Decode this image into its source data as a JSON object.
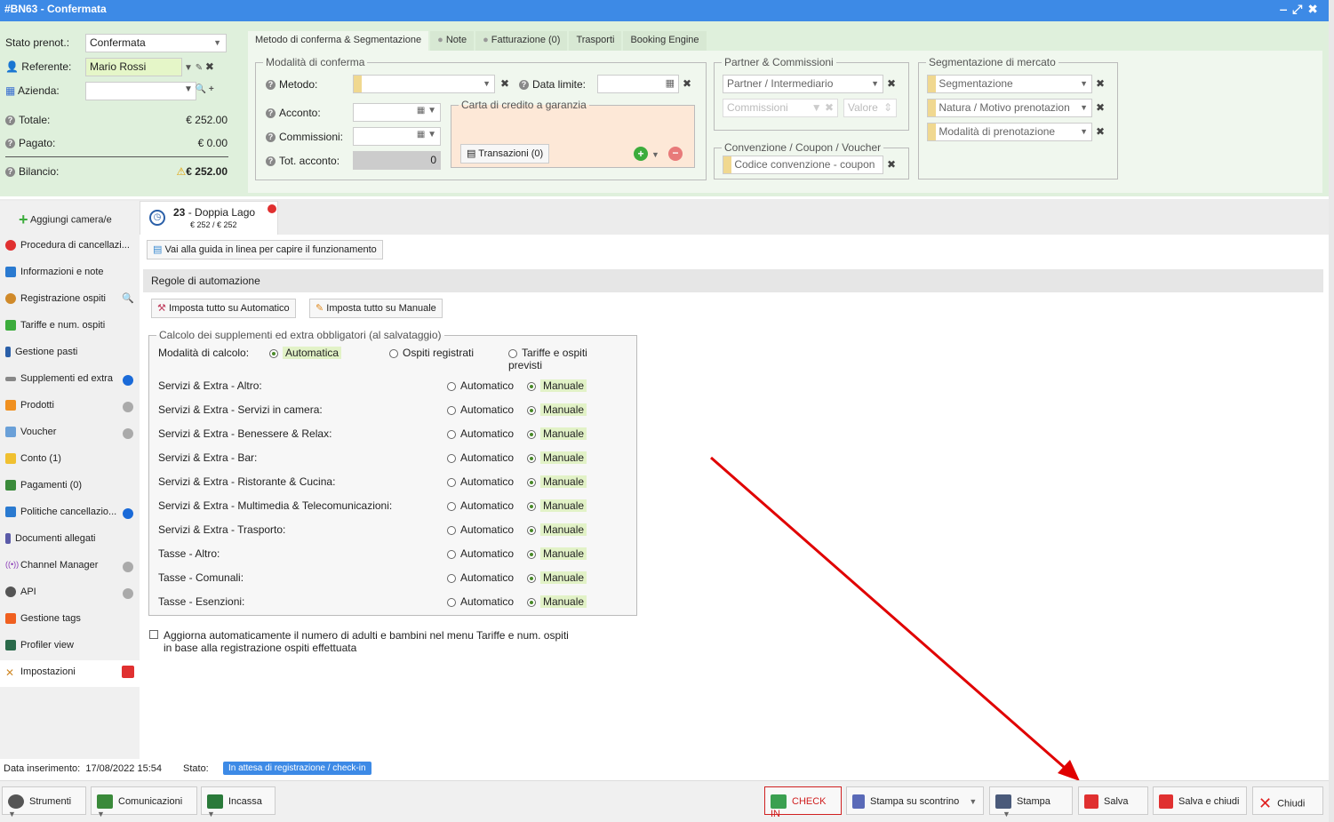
{
  "window": {
    "title": "#BN63 - Confermata"
  },
  "header": {
    "stato_label": "Stato prenot.:",
    "stato_value": "Confermata",
    "referente_label": "Referente:",
    "referente_value": "Mario Rossi",
    "azienda_label": "Azienda:",
    "totale_label": "Totale:",
    "totale_value": "€ 252.00",
    "pagato_label": "Pagato:",
    "pagato_value": "€ 0.00",
    "bilancio_label": "Bilancio:",
    "bilancio_value": "€ 252.00"
  },
  "tabs": [
    "Metodo di conferma & Segmentazione",
    "Note",
    "Fatturazione (0)",
    "Trasporti",
    "Booking Engine"
  ],
  "conferma": {
    "legend": "Modalità di conferma",
    "metodo": "Metodo:",
    "data_limite": "Data limite:",
    "acconto": "Acconto:",
    "commissioni": "Commissioni:",
    "tot_acconto": "Tot. acconto:",
    "tot_acconto_value": "0",
    "carta_legend": "Carta di credito a garanzia",
    "transazioni": "Transazioni (0)"
  },
  "partner": {
    "legend": "Partner & Commissioni",
    "intermediario": "Partner / Intermediario",
    "commissioni": "Commissioni",
    "valore": "Valore"
  },
  "convenzione": {
    "legend": "Convenzione / Coupon / Voucher",
    "codice": "Codice convenzione - coupon"
  },
  "segmentazione": {
    "legend": "Segmentazione di mercato",
    "seg": "Segmentazione",
    "natura": "Natura / Motivo prenotazion",
    "modalita": "Modalità di prenotazione"
  },
  "room": {
    "number": "23",
    "name": " - Doppia Lago",
    "price": "€ 252 / € 252"
  },
  "sidebar": {
    "add": "Aggiungi camera/e",
    "items": [
      "Procedura di cancellazi...",
      "Informazioni e note",
      "Registrazione ospiti",
      "Tariffe e num. ospiti",
      "Gestione pasti",
      "Supplementi ed extra",
      "Prodotti",
      "Voucher",
      "Conto (1)",
      "Pagamenti (0)",
      "Politiche cancellazio...",
      "Documenti allegati",
      "Channel Manager",
      "API",
      "Gestione tags",
      "Profiler view",
      "Impostazioni"
    ]
  },
  "main": {
    "guide": "Vai alla guida in linea per capire il funzionamento",
    "section": "Regole di automazione",
    "auto_all": "Imposta tutto su Automatico",
    "man_all": "Imposta tutto su Manuale",
    "calc_legend": "Calcolo dei supplementi ed extra obbligatori (al salvataggio)",
    "modalita_label": "Modalità di calcolo:",
    "opt_auto": "Automatica",
    "opt_ospiti": "Ospiti registrati",
    "opt_tariffe": "Tariffe e ospiti previsti",
    "automatico": "Automatico",
    "manuale": "Manuale",
    "rows": [
      "Servizi & Extra - Altro:",
      "Servizi & Extra - Servizi in camera:",
      "Servizi & Extra - Benessere & Relax:",
      "Servizi & Extra - Bar:",
      "Servizi & Extra - Ristorante & Cucina:",
      "Servizi & Extra - Multimedia & Telecomunicazioni:",
      "Servizi & Extra - Trasporto:",
      "Tasse - Altro:",
      "Tasse - Comunali:",
      "Tasse - Esenzioni:"
    ],
    "checkbox_text1": "Aggiorna automaticamente il numero di adulti e bambini nel menu Tariffe e num. ospiti",
    "checkbox_text2": "in base alla registrazione ospiti effettuata"
  },
  "status": {
    "data_label": "Data inserimento:",
    "data_value": "17/08/2022 15:54",
    "stato_label": "Stato:",
    "stato_value": "In attesa di registrazione / check-in"
  },
  "footer": {
    "strumenti": "Strumenti",
    "comunicazioni": "Comunicazioni",
    "incassa": "Incassa",
    "checkin": "CHECK IN",
    "scontrino": "Stampa su scontrino",
    "stampa": "Stampa",
    "salva": "Salva",
    "salva_chiudi": "Salva e chiudi",
    "chiudi": "Chiudi"
  }
}
